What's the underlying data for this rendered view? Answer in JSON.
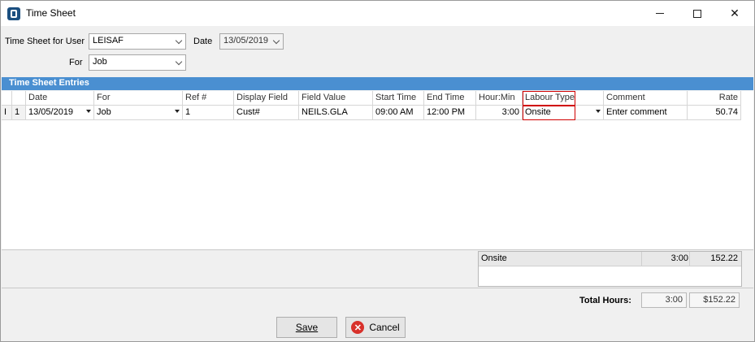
{
  "window": {
    "title": "Time Sheet"
  },
  "filters": {
    "user_label": "Time Sheet for User",
    "user_value": "LEISAF",
    "date_label": "Date",
    "date_value": "13/05/2019",
    "for_label": "For",
    "for_value": "Job"
  },
  "section": {
    "title": "Time Sheet Entries"
  },
  "grid": {
    "columns": [
      "Date",
      "For",
      "Ref #",
      "Display Field",
      "Field Value",
      "Start Time",
      "End Time",
      "Hour:Min",
      "Labour Type",
      "Comment",
      "Rate"
    ],
    "rows": [
      {
        "indicator": "I",
        "num": "1",
        "date": "13/05/2019",
        "for": "Job",
        "ref": "1",
        "display_field": "Cust#",
        "field_value": "NEILS.GLA",
        "start": "09:00 AM",
        "end": "12:00 PM",
        "hour_min": "3:00",
        "labour_type": "Onsite",
        "comment": "Enter comment",
        "rate": "50.74"
      }
    ]
  },
  "summary": {
    "rows": [
      {
        "type": "Onsite",
        "hours": "3:00",
        "amount": "152.22"
      }
    ]
  },
  "totals": {
    "label": "Total Hours:",
    "hours": "3:00",
    "amount": "$152.22"
  },
  "buttons": {
    "save": "Save",
    "cancel": "Cancel"
  },
  "colors": {
    "section_bar": "#4a8fd1",
    "highlight": "#d00000",
    "cancel_icon": "#d8312b"
  }
}
